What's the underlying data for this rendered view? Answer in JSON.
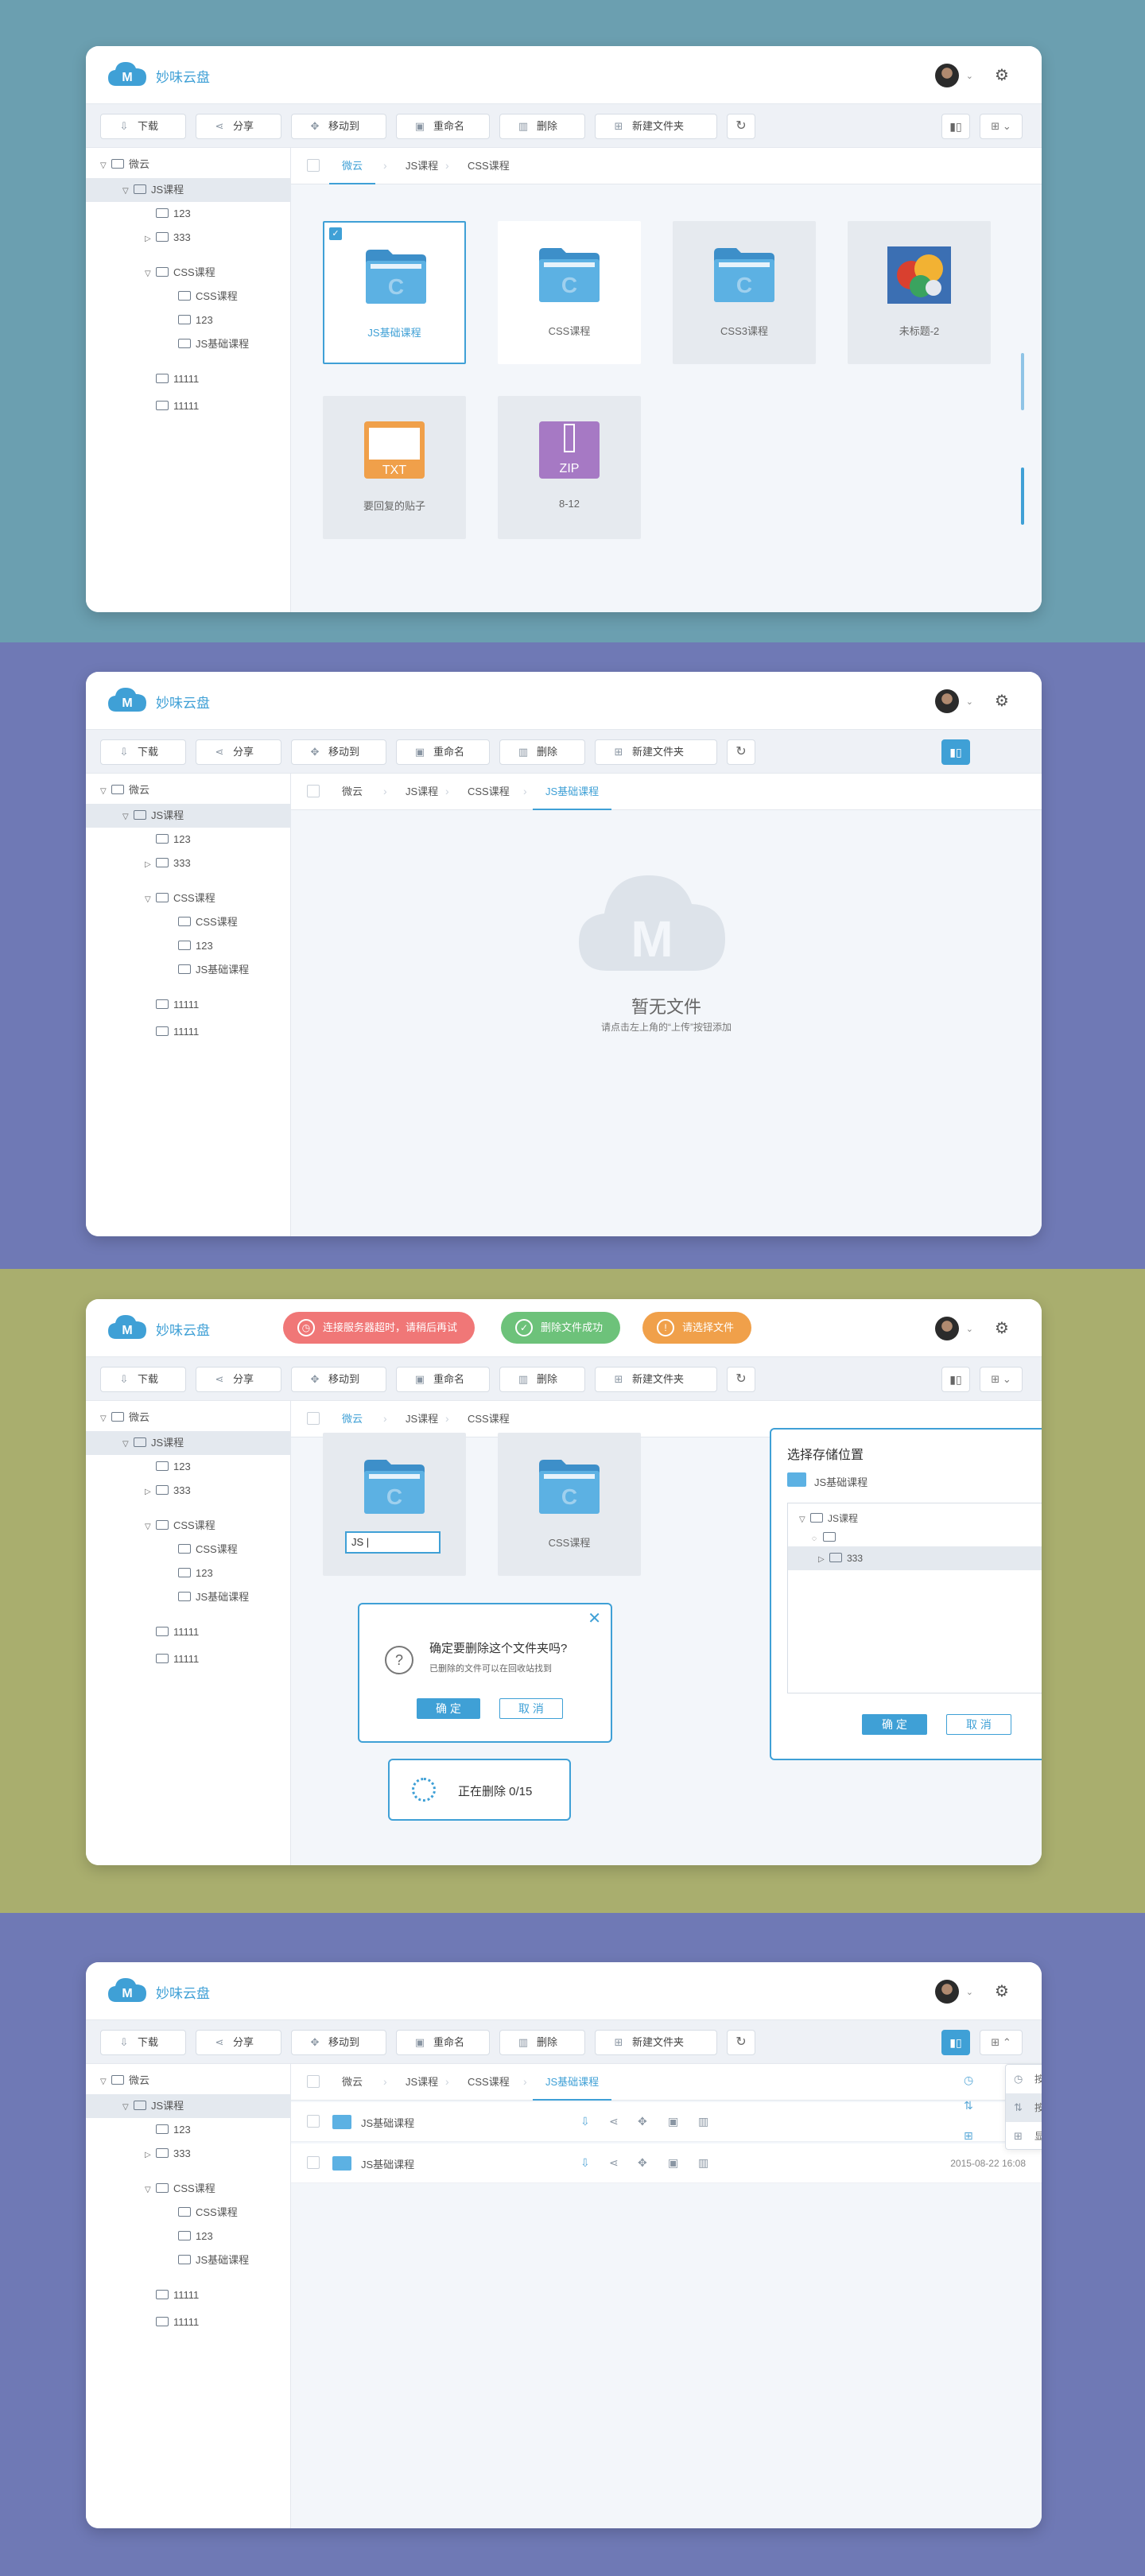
{
  "app": {
    "brand": "妙味云盘",
    "logo_letter": "M"
  },
  "colors": {
    "bg1": "#6b9fb0",
    "bg2": "#6f79b5",
    "bg3": "#a9ae6e",
    "bg4": "#6f79b5",
    "accent": "#3fa0d6",
    "red": "#f07777",
    "green": "#6dc27a",
    "orange": "#f0a04a"
  },
  "toolbar": {
    "download": "下载",
    "share": "分享",
    "move": "移动到",
    "rename": "重命名",
    "delete": "删除",
    "newfolder": "新建文件夹"
  },
  "tree": {
    "root": "微云",
    "js": "JS课程",
    "n123": "123",
    "n333": "333",
    "css": "CSS课程",
    "css_css": "CSS课程",
    "css_123": "123",
    "css_js": "JS基础课程",
    "t1": "11111",
    "t2": "11111"
  },
  "crumbs": {
    "c1": "微云",
    "c2": "JS课程",
    "c3": "CSS课程",
    "c4": "JS基础课程"
  },
  "panel1": {
    "tiles": [
      {
        "name": "JS基础课程"
      },
      {
        "name": "CSS课程"
      },
      {
        "name": "CSS3课程"
      },
      {
        "name": "未标题-2"
      },
      {
        "name": "要回复的贴子"
      },
      {
        "name": "8-12"
      }
    ],
    "txt": "TXT",
    "zip": "ZIP"
  },
  "panel2": {
    "empty_title": "暂无文件",
    "empty_hint": "请点击左上角的“上传”按钮添加"
  },
  "panel3": {
    "toasts": {
      "err": "连接服务器超时，请稍后再试",
      "ok": "删除文件成功",
      "warn": "请选择文件"
    },
    "rename_value": "JS |",
    "tile2": "CSS课程",
    "confirm": {
      "title": "确定要删除这个文件夹吗?",
      "sub": "已删除的文件可以在回收站找到",
      "ok": "确 定",
      "cancel": "取 消"
    },
    "progress": "正在删除 0/15",
    "move": {
      "title": "选择存储位置",
      "current": "JS基础课程",
      "tree_js": "JS课程",
      "tree_333": "333",
      "ok": "确 定",
      "cancel": "取 消"
    }
  },
  "panel4": {
    "rows": [
      {
        "name": "JS基础课程",
        "date": ""
      },
      {
        "name": "JS基础课程",
        "date": "2015-08-22 16:08"
      }
    ],
    "menu": {
      "by_time": "按时间排序",
      "by_alpha": "按字母排序",
      "thumb": "显示缩略图"
    }
  }
}
